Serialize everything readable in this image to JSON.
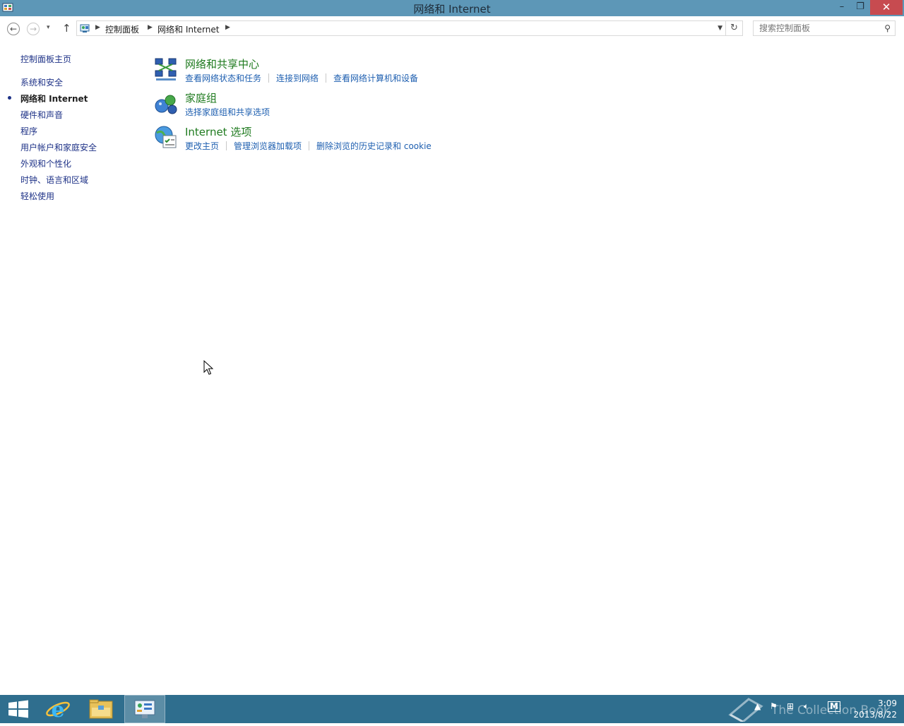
{
  "window": {
    "title": "网络和 Internet",
    "minimize": "–",
    "maximize": "❐",
    "close": "✕"
  },
  "nav": {
    "back": "←",
    "forward": "→",
    "dropdown": "▾",
    "up": "↑",
    "breadcrumbs": [
      "控制面板",
      "网络和 Internet"
    ],
    "refresh": "↻",
    "search_placeholder": "搜索控制面板"
  },
  "sidebar": {
    "home": "控制面板主页",
    "items": [
      {
        "label": "系统和安全",
        "current": false
      },
      {
        "label": "网络和 Internet",
        "current": true
      },
      {
        "label": "硬件和声音",
        "current": false
      },
      {
        "label": "程序",
        "current": false
      },
      {
        "label": "用户帐户和家庭安全",
        "current": false
      },
      {
        "label": "外观和个性化",
        "current": false
      },
      {
        "label": "时钟、语言和区域",
        "current": false
      },
      {
        "label": "轻松使用",
        "current": false
      }
    ]
  },
  "categories": [
    {
      "title": "网络和共享中心",
      "icon": "network-sharing-center-icon",
      "links": [
        "查看网络状态和任务",
        "连接到网络",
        "查看网络计算机和设备"
      ]
    },
    {
      "title": "家庭组",
      "icon": "homegroup-icon",
      "links": [
        "选择家庭组和共享选项"
      ]
    },
    {
      "title": "Internet 选项",
      "icon": "internet-options-icon",
      "links": [
        "更改主页",
        "管理浏览器加载项",
        "删除浏览的历史记录和 cookie"
      ]
    }
  ],
  "taskbar": {
    "watermark": "The Collection Book",
    "clock_time": "3:09",
    "clock_date": "2013/8/22",
    "tray_ime": "M"
  },
  "colors": {
    "titlebar": "#5d97b7",
    "close": "#c74b50",
    "taskbar": "#2f6e8e",
    "category_title": "#1e7a1e",
    "link": "#1e5fb0"
  }
}
